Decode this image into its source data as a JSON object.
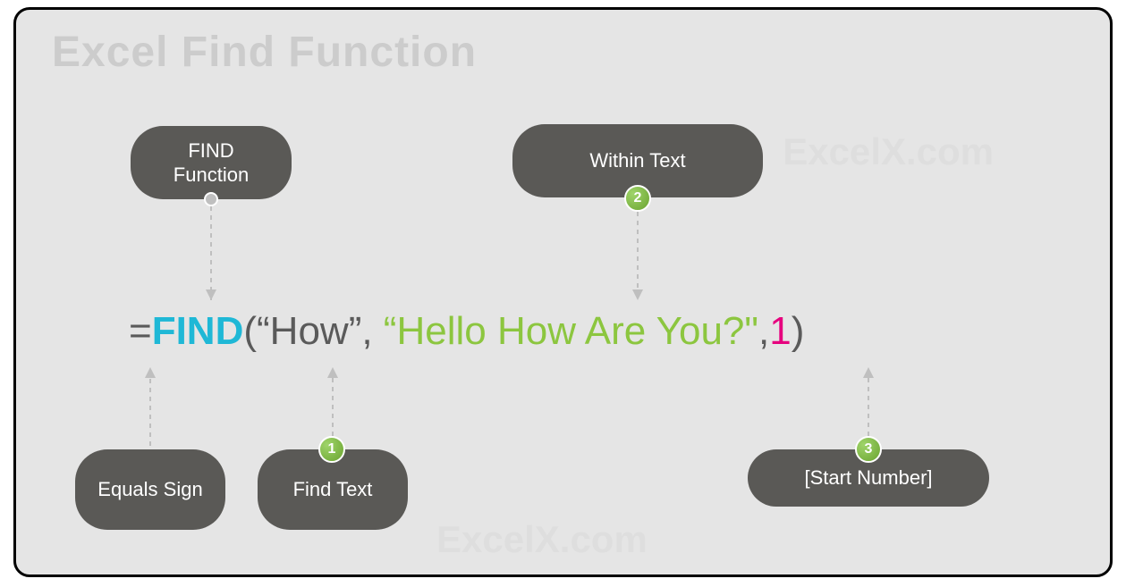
{
  "title": "Excel Find Function",
  "watermark": "ExcelX.com",
  "formula": {
    "eq": "=",
    "func": "FIND",
    "open": "(",
    "arg_how": "“How”",
    "comma1": ", ",
    "arg_within": "“Hello How Are You?\"",
    "comma2": ",",
    "arg_num": "1",
    "close": ")"
  },
  "labels": {
    "find_function": "FIND Function",
    "within_text": "Within Text",
    "equals_sign": "Equals Sign",
    "find_text": "Find Text",
    "start_number": "[Start Number]"
  },
  "badges": {
    "b1": "1",
    "b2": "2",
    "b3": "3"
  }
}
